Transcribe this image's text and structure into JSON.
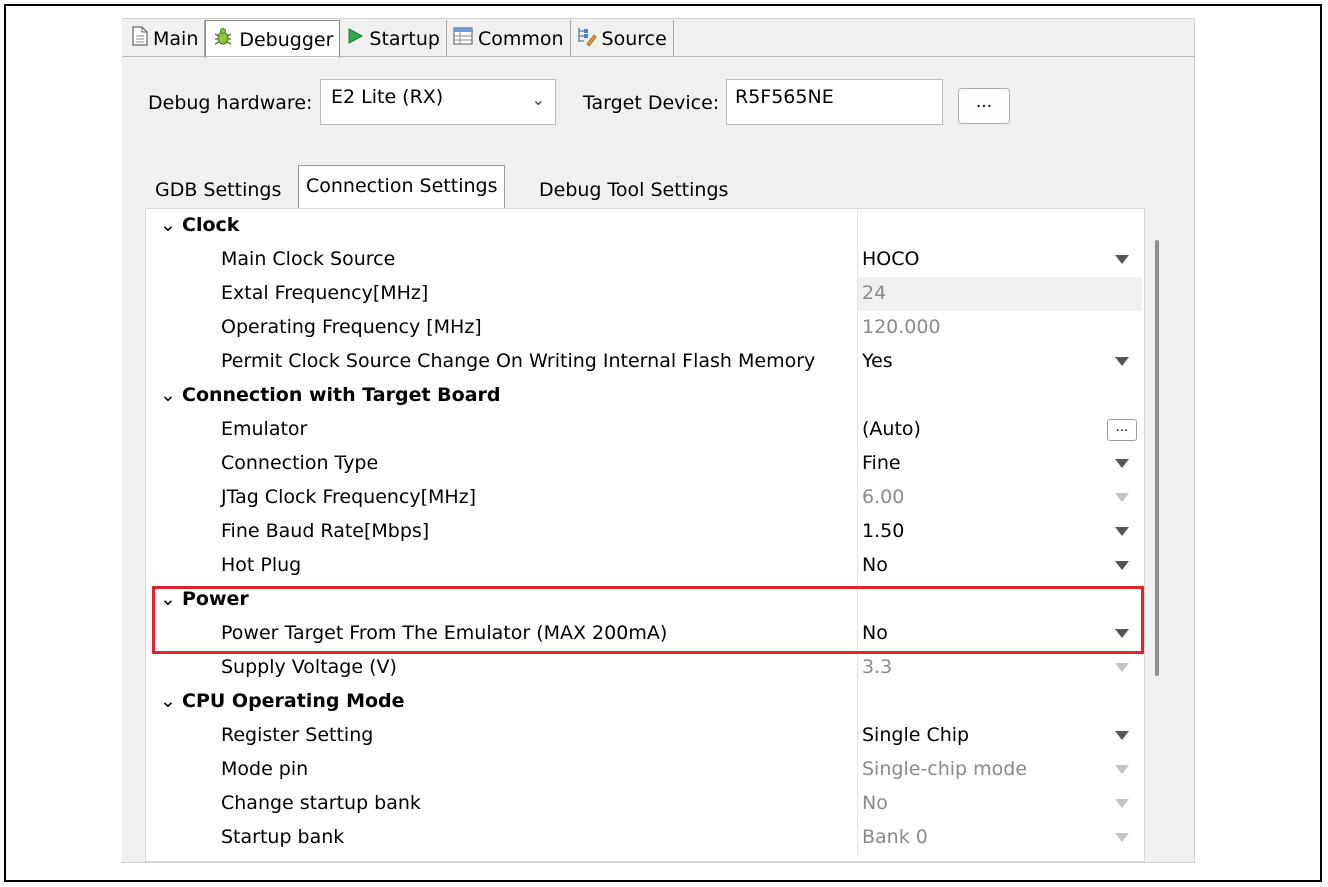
{
  "top_tabs": [
    {
      "label": "Main",
      "icon": "document-icon"
    },
    {
      "label": "Debugger",
      "icon": "bug-icon",
      "active": true
    },
    {
      "label": "Startup",
      "icon": "play-icon"
    },
    {
      "label": "Common",
      "icon": "table-icon"
    },
    {
      "label": "Source",
      "icon": "source-icon"
    }
  ],
  "debug_hardware": {
    "label": "Debug hardware:",
    "value": "E2 Lite (RX)"
  },
  "target_device": {
    "label": "Target Device:",
    "value": "R5F565NE",
    "browse_label": "..."
  },
  "inner_tabs": [
    {
      "label": "GDB Settings"
    },
    {
      "label": "Connection Settings",
      "active": true
    },
    {
      "label": "Debug Tool Settings"
    }
  ],
  "table": {
    "groups": [
      {
        "title": "Clock",
        "rows": [
          {
            "name": "Main Clock Source",
            "value": "HOCO"
          },
          {
            "name": "Extal Frequency[MHz]",
            "value": "24"
          },
          {
            "name": "Operating Frequency [MHz]",
            "value": "120.000"
          },
          {
            "name": "Permit Clock Source Change On Writing Internal Flash Memory",
            "value": "Yes"
          }
        ]
      },
      {
        "title": "Connection with Target Board",
        "rows": [
          {
            "name": "Emulator",
            "value": "(Auto)",
            "button": "..."
          },
          {
            "name": "Connection Type",
            "value": "Fine"
          },
          {
            "name": "JTag Clock Frequency[MHz]",
            "value": "6.00"
          },
          {
            "name": "Fine Baud Rate[Mbps]",
            "value": "1.50"
          },
          {
            "name": "Hot Plug",
            "value": "No"
          }
        ]
      },
      {
        "title": "Power",
        "rows": [
          {
            "name": "Power Target From The Emulator (MAX 200mA)",
            "value": "No"
          },
          {
            "name": "Supply Voltage (V)",
            "value": "3.3"
          }
        ]
      },
      {
        "title": "CPU Operating Mode",
        "rows": [
          {
            "name": "Register Setting",
            "value": "Single Chip"
          },
          {
            "name": "Mode pin",
            "value": "Single-chip mode"
          },
          {
            "name": "Change startup bank",
            "value": "No"
          },
          {
            "name": "Startup bank",
            "value": "Bank 0"
          }
        ]
      }
    ]
  },
  "colors": {
    "highlight": "#e0242b"
  }
}
